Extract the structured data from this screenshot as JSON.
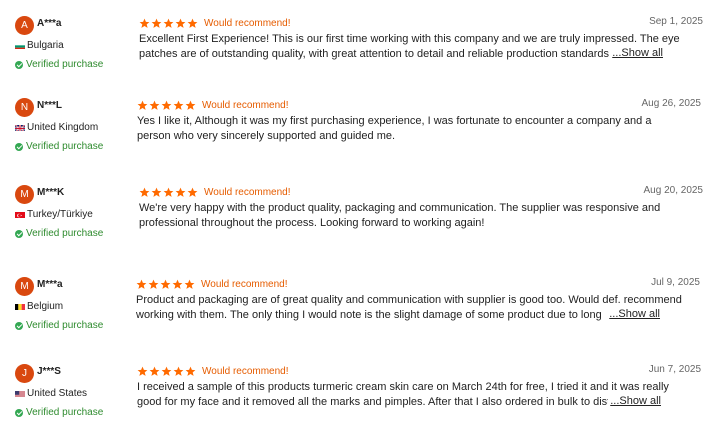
{
  "reviews": [
    {
      "initial": "A",
      "name": "A***a",
      "country": "Bulgaria",
      "flag": "bulgaria",
      "verified": "Verified purchase",
      "rating": 5,
      "recommend": "Would recommend!",
      "date": "Sep 1, 2025",
      "text": "Excellent First Experience! This is our first time working with this company and we are truly impressed. The eye patches are of outstanding quality, with great attention to detail and reliable production standards",
      "show_all": "...Show all"
    },
    {
      "initial": "N",
      "name": "N***L",
      "country": "United Kingdom",
      "flag": "uk",
      "verified": "Verified purchase",
      "rating": 5,
      "recommend": "Would recommend!",
      "date": "Aug 26, 2025",
      "text": "Yes I like it, Although it was my first purchasing experience, I was fortunate to encounter a company and a person who very sincerely supported and guided me.",
      "show_all": ""
    },
    {
      "initial": "M",
      "name": "M***K",
      "country": "Turkey/Türkiye",
      "flag": "turkey",
      "verified": "Verified purchase",
      "rating": 5,
      "recommend": "Would recommend!",
      "date": "Aug 20, 2025",
      "text": "We're very happy with the product quality, packaging and communication. The supplier was responsive and professional throughout the process. Looking forward to working again!",
      "show_all": ""
    },
    {
      "initial": "M",
      "name": "M***a",
      "country": "Belgium",
      "flag": "belgium",
      "verified": "Verified purchase",
      "rating": 5,
      "recommend": "Would recommend!",
      "date": "Jul 9, 2025",
      "text": "Product and packaging are of great quality and communication with supplier is good too. Would def. recommend working with them. The only thing I would note is the slight damage of some product due to long",
      "show_all": "...Show all"
    },
    {
      "initial": "J",
      "name": "J***S",
      "country": "United States",
      "flag": "us",
      "verified": "Verified purchase",
      "rating": 5,
      "recommend": "Would recommend!",
      "date": "Jun 7, 2025",
      "text": "I received a sample of this products turmeric cream skin care on March 24th for free, I tried it and it was really good for my face and it removed all the marks and pimples. After that I also ordered in bulk to distribute",
      "show_all": "...Show all"
    }
  ],
  "colors": {
    "star": "#ff6a00",
    "recommend": "#e65c00",
    "avatar": "#d9480f",
    "verified": "#2e8b2e"
  }
}
